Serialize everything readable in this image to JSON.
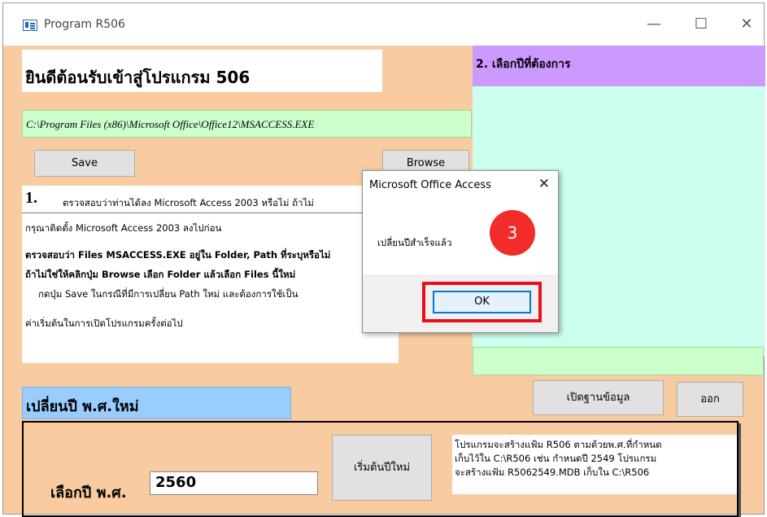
{
  "window": {
    "title": "Program R506",
    "minimize": "—",
    "maximize": "☐",
    "close": "✕"
  },
  "main": {
    "welcome": "ยินดีต้อนรับเข้าสู่โปรแกรม 506",
    "access_path": "C:\\Program Files (x86)\\Microsoft Office\\Office12\\MSACCESS.EXE",
    "save_label": "Save",
    "browse_label": "Browse"
  },
  "instructions": {
    "step_number": "1.",
    "line1": "ตรวจสอบว่าท่านได้ลง Microsoft Access 2003 หรือไม่ ถ้าไม่",
    "line2": "กรุณาติดตั้ง Microsoft Access 2003 ลงไปก่อน",
    "line3": "ตรวจสอบว่า Files  MSACCESS.EXE อยู่ใน Folder, Path ที่ระบุหรือไม่",
    "line4": "ถ้าไม่ใช่ให้คลิกปุ่ม  Browse เลือก Folder แล้วเลือก Files นี้ใหม่",
    "line5": "กดปุ่ม Save ในกรณีที่มีการเปลี่ยน Path ใหม่ และต้องการใช้เป็น",
    "line6": "ค่าเริ่มต้นในการเปิดโปรแกรมครั้งต่อไป"
  },
  "right_panel": {
    "header": "2. เลือกปีที่ต้องการ"
  },
  "actions": {
    "open_db": "เปิดฐานข้อมูล",
    "exit": "ออก"
  },
  "year_section": {
    "header": "เปลี่ยนปี พ.ศ.ใหม่",
    "label": "เลือกปี พ.ศ.",
    "year_value": "2560",
    "start_button": "เริ่มต้นปีใหม่",
    "note1": "โปรแกรมจะสร้างแฟ้ม R506 ตามด้วยพ.ศ.ที่กำหนด",
    "note2": "เก็บไว้ใน C:\\R506 เช่น กำหนดปี 2549 โปรแกรม",
    "note3": "จะสร้างแฟ้ม R5062549.MDB  เก็บใน C:\\R506"
  },
  "dialog": {
    "title": "Microsoft Office Access",
    "close": "✕",
    "message": "เปลี่ยนปีสำเร็จแล้ว",
    "ok_label": "OK",
    "step_marker": "3"
  },
  "colors": {
    "form_bg": "#f9cba0",
    "right_panel_bg": "#ccffee",
    "right_panel_header": "#cc99ff",
    "path_bg": "#ccffcc",
    "year_header_bg": "#99ccff",
    "marker": "#f22b2b",
    "highlight": "#e8101c"
  }
}
